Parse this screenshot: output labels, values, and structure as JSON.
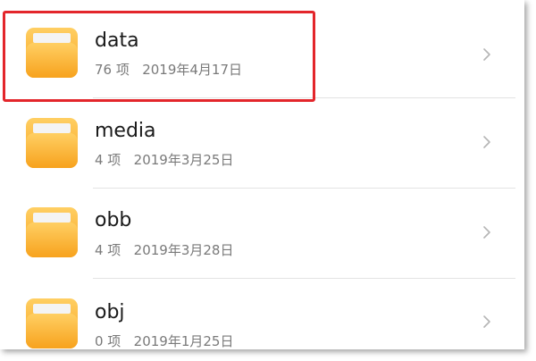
{
  "folders": [
    {
      "name": "data",
      "count": "76 项",
      "date": "2019年4月17日"
    },
    {
      "name": "media",
      "count": "4 项",
      "date": "2019年3月25日"
    },
    {
      "name": "obb",
      "count": "4 项",
      "date": "2019年3月28日"
    },
    {
      "name": "obj",
      "count": "0 项",
      "date": "2019年1月25日"
    }
  ],
  "colors": {
    "folder_gradient_top": "#ffcf63",
    "folder_gradient_bottom": "#f7a21d",
    "folder_tab": "#f4f4f4",
    "highlight": "#e3262b",
    "chevron": "#b5b5b5"
  },
  "icons": {
    "folder": "folder-icon",
    "chevron": "chevron-right-icon"
  }
}
